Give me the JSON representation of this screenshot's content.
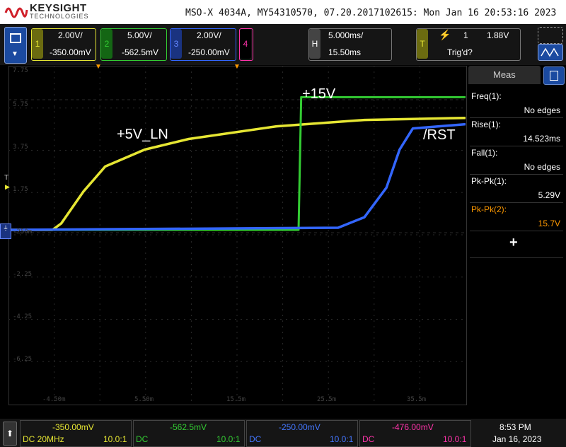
{
  "header": {
    "brand": "KEYSIGHT",
    "brand_sub": "TECHNOLOGIES",
    "model_line": "MSO-X 4034A, MY54310570, 07.20.2017102615: Mon Jan 16 20:53:16 2023"
  },
  "channels": [
    {
      "num": "1",
      "scale": "2.00V/",
      "offset": "-350.00mV",
      "color": "#e6e633"
    },
    {
      "num": "2",
      "scale": "5.00V/",
      "offset": "-562.5mV",
      "color": "#33cc33"
    },
    {
      "num": "3",
      "scale": "2.00V/",
      "offset": "-250.00mV",
      "color": "#3366ff"
    },
    {
      "num": "4",
      "scale": "",
      "offset": "",
      "color": "#ff33aa"
    }
  ],
  "horizontal": {
    "label": "H",
    "scale": "5.000ms/",
    "position": "15.50ms"
  },
  "trigger": {
    "label": "T",
    "channel": "1",
    "level": "1.88V",
    "status": "Trig'd?"
  },
  "display": {
    "y_ticks": [
      "7.75",
      "5.75",
      "3.75",
      "1.75",
      "-250m",
      "-2.25",
      "-4.25",
      "-6.25"
    ],
    "x_ticks": [
      "-4.50m",
      "5.50m",
      "15.5m",
      "25.5m",
      "35.5m"
    ],
    "t_marker": "T",
    "annotations": {
      "plus15": "+15V",
      "plus5": "+5V_LN",
      "rst": "/RST"
    }
  },
  "chart_data": {
    "type": "line",
    "xlabel": "",
    "ylabel": "",
    "x_unit": "ms",
    "xlim": [
      -10.5,
      41.5
    ],
    "series": [
      {
        "name": "+5V_LN",
        "channel": 1,
        "x": [
          -10.5,
          -5.5,
          -4.5,
          -2,
          0.5,
          5,
          10,
          20,
          30,
          41.5
        ],
        "values": [
          0,
          0,
          0.3,
          1.8,
          3.0,
          3.8,
          4.3,
          4.9,
          5.2,
          5.3
        ]
      },
      {
        "name": "+15V",
        "channel": 2,
        "x": [
          -10.5,
          22.5,
          22.8,
          41.5
        ],
        "values": [
          0,
          0,
          15.7,
          15.7
        ]
      },
      {
        "name": "/RST",
        "channel": 3,
        "x": [
          -10.5,
          27,
          30,
          32.5,
          34,
          35.5,
          41.5
        ],
        "values": [
          0,
          0.1,
          0.6,
          2.0,
          3.8,
          4.8,
          5.0
        ]
      }
    ]
  },
  "meas": {
    "title": "Meas",
    "items": [
      {
        "label": "Freq(1):",
        "value": "No edges",
        "color": "#ffffff"
      },
      {
        "label": "Rise(1):",
        "value": "14.523ms",
        "color": "#ffffff"
      },
      {
        "label": "Fall(1):",
        "value": "No edges",
        "color": "#ffffff"
      },
      {
        "label": "Pk-Pk(1):",
        "value": "5.29V",
        "color": "#ffffff"
      },
      {
        "label": "Pk-Pk(2):",
        "value": "15.7V",
        "color": "#ff9900"
      }
    ],
    "add_label": "+"
  },
  "bottom": {
    "cells": [
      {
        "value": "-350.00mV",
        "coupling": "DC 20MHz",
        "probe": "10.0:1",
        "color": "#e6e633"
      },
      {
        "value": "-562.5mV",
        "coupling": "DC",
        "probe": "10.0:1",
        "color": "#33cc33"
      },
      {
        "value": "-250.00mV",
        "coupling": "DC",
        "probe": "10.0:1",
        "color": "#4477ff"
      },
      {
        "value": "-476.00mV",
        "coupling": "DC",
        "probe": "10.0:1",
        "color": "#ff33aa"
      }
    ],
    "time": "8:53 PM",
    "date": "Jan 16, 2023"
  }
}
